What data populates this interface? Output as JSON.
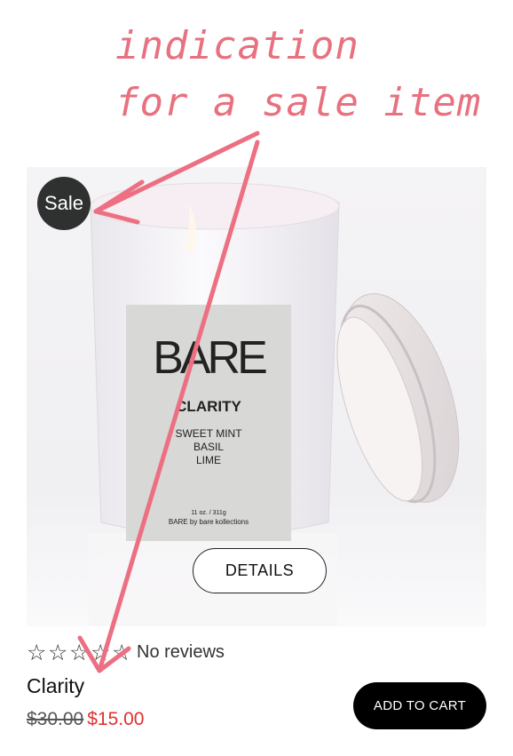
{
  "annotation": {
    "line1": "indication",
    "line2": "for a sale item",
    "color": "#e8717f"
  },
  "product": {
    "badge": "Sale",
    "image_label": {
      "brand": "BARE",
      "name": "CLARITY",
      "notes": [
        "SWEET MINT",
        "BASIL",
        "LIME"
      ],
      "size": "11 oz. / 311g",
      "maker": "BARE by bare kollections"
    },
    "details_label": "DETAILS",
    "rating": {
      "stars": 0,
      "max_stars": 5,
      "reviews_text": "No reviews"
    },
    "title": "Clarity",
    "price_original": "$30.00",
    "price_sale": "$15.00",
    "add_to_cart_label": "ADD TO CART"
  },
  "colors": {
    "sale_price": "#e0312d",
    "badge_bg": "#2f3030",
    "cart_bg": "#000000"
  }
}
